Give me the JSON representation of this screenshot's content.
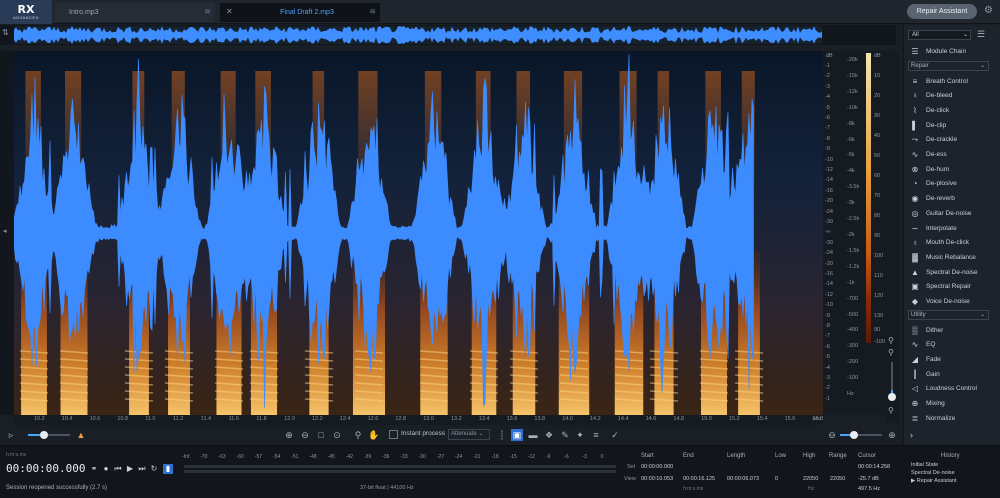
{
  "app": {
    "logo": "RX",
    "logo_sub": "ADVANCED"
  },
  "tabs": [
    {
      "label": "Intro.mp3",
      "active": false
    },
    {
      "label": "Final Draft 2.mp3",
      "active": true
    }
  ],
  "header": {
    "repair_assistant": "Repair Assistant"
  },
  "ruler": {
    "db_header": "dB",
    "db_ticks": [
      "-1",
      "-2",
      "-3",
      "-4",
      "-5",
      "-6",
      "-7",
      "-8",
      "-9",
      "-10",
      "-12",
      "-14",
      "-16",
      "-20",
      "-24",
      "-30",
      "-∞",
      "-30",
      "-24",
      "-20",
      "-16",
      "-14",
      "-12",
      "-10",
      "-9",
      "-8",
      "-7",
      "-6",
      "-5",
      "-4",
      "-3",
      "-2",
      "-1"
    ],
    "hz_ticks": [
      "-20k",
      "-15k",
      "-12k",
      "-10k",
      "-8k",
      "-6k",
      "-5k",
      "-4k",
      "-3.5k",
      "-3k",
      "-2.5k",
      "-2k",
      "-1.5k",
      "-1.2k",
      "-1k",
      "-700",
      "-500",
      "-400",
      "-300",
      "-200",
      "-100",
      "Hz"
    ],
    "right_db": [
      "dB",
      "10",
      "20",
      "30",
      "40",
      "50",
      "60",
      "70",
      "80",
      "90",
      "100",
      "110",
      "120",
      "130"
    ],
    "right_db_bottom": [
      "90",
      "-100"
    ]
  },
  "time_axis": {
    "ticks": [
      "10.2",
      "10.4",
      "10.6",
      "10.8",
      "11.0",
      "11.2",
      "11.4",
      "11.6",
      "11.8",
      "12.0",
      "12.2",
      "12.4",
      "12.6",
      "12.8",
      "13.0",
      "13.2",
      "13.4",
      "13.6",
      "13.8",
      "14.0",
      "14.2",
      "14.4",
      "14.6",
      "14.8",
      "15.0",
      "15.2",
      "15.4",
      "15.6",
      "15.8"
    ],
    "unit": "sec"
  },
  "panel": {
    "filter": "All",
    "module_chain": "Module Chain",
    "repair_section": "Repair",
    "repair_modules": [
      {
        "label": "Breath Control",
        "icon": "breath-control-icon",
        "glyph": "≡"
      },
      {
        "label": "De-bleed",
        "icon": "de-bleed-icon",
        "glyph": "♀"
      },
      {
        "label": "De-click",
        "icon": "de-click-icon",
        "glyph": "⌇"
      },
      {
        "label": "De-clip",
        "icon": "de-clip-icon",
        "glyph": "▌"
      },
      {
        "label": "De-crackle",
        "icon": "de-crackle-icon",
        "glyph": "⤳"
      },
      {
        "label": "De-ess",
        "icon": "de-ess-icon",
        "glyph": "∿"
      },
      {
        "label": "De-hum",
        "icon": "de-hum-icon",
        "glyph": "⊗"
      },
      {
        "label": "De-plosive",
        "icon": "de-plosive-icon",
        "glyph": "◔"
      },
      {
        "label": "De-reverb",
        "icon": "de-reverb-icon",
        "glyph": "◉"
      },
      {
        "label": "Guitar De-noise",
        "icon": "guitar-de-noise-icon",
        "glyph": "◎"
      },
      {
        "label": "Interpolate",
        "icon": "interpolate-icon",
        "glyph": "∼"
      },
      {
        "label": "Mouth De-click",
        "icon": "mouth-de-click-icon",
        "glyph": "♁"
      },
      {
        "label": "Music Rebalance",
        "icon": "music-rebalance-icon",
        "glyph": "▓"
      },
      {
        "label": "Spectral De-noise",
        "icon": "spectral-de-noise-icon",
        "glyph": "▲"
      },
      {
        "label": "Spectral Repair",
        "icon": "spectral-repair-icon",
        "glyph": "▣"
      },
      {
        "label": "Voice De-noise",
        "icon": "voice-de-noise-icon",
        "glyph": "◆"
      }
    ],
    "utility_section": "Utility",
    "utility_modules": [
      {
        "label": "Dither",
        "icon": "dither-icon",
        "glyph": "▒"
      },
      {
        "label": "EQ",
        "icon": "eq-icon",
        "glyph": "∿"
      },
      {
        "label": "Fade",
        "icon": "fade-icon",
        "glyph": "◢"
      },
      {
        "label": "Gain",
        "icon": "gain-icon",
        "glyph": "┃"
      },
      {
        "label": "Loudness Control",
        "icon": "loudness-control-icon",
        "glyph": "◁"
      },
      {
        "label": "Mixing",
        "icon": "mixing-icon",
        "glyph": "⊕"
      },
      {
        "label": "Normalize",
        "icon": "normalize-icon",
        "glyph": "≣"
      }
    ]
  },
  "toolbar": {
    "instant_process": "Instant process",
    "attenuate": "Attenuate"
  },
  "transport": {
    "bpm_label": "h:m:s.ms",
    "timecode": "00:00:00.000",
    "status": "Session reopened successfully (2.7 s)",
    "levels": [
      "-Inf.",
      "-70",
      "-63",
      "-60",
      "-57",
      "-54",
      "-51",
      "-48",
      "-45",
      "-42",
      "-39",
      "-36",
      "-33",
      "-30",
      "-27",
      "-24",
      "-21",
      "-18",
      "-15",
      "-12",
      "-9",
      "-6",
      "-3",
      "0"
    ],
    "format": "37-bit float | 44100 Hz"
  },
  "selection": {
    "headers": [
      "Start",
      "End",
      "Length",
      "Low",
      "High",
      "Range",
      "Cursor"
    ],
    "sel_label": "Sel",
    "view_label": "View",
    "sel_start": "00:00:00.000",
    "view_start": "00:00:10.053",
    "view_end": "00:00:16.125",
    "view_length": "00:00:06.073",
    "view_low": "0",
    "view_high": "22050",
    "view_range": "22050",
    "cursor1": "00:00:14.258",
    "cursor2": "-25.7 dB",
    "cursor3": "497.5 Hz",
    "unit_time": "h:m:s.ms",
    "unit_hz": "Hz"
  },
  "history": {
    "title": "History",
    "items": [
      "Initial State",
      "Spectral De-noise",
      "▶ Repair Assistant"
    ]
  }
}
